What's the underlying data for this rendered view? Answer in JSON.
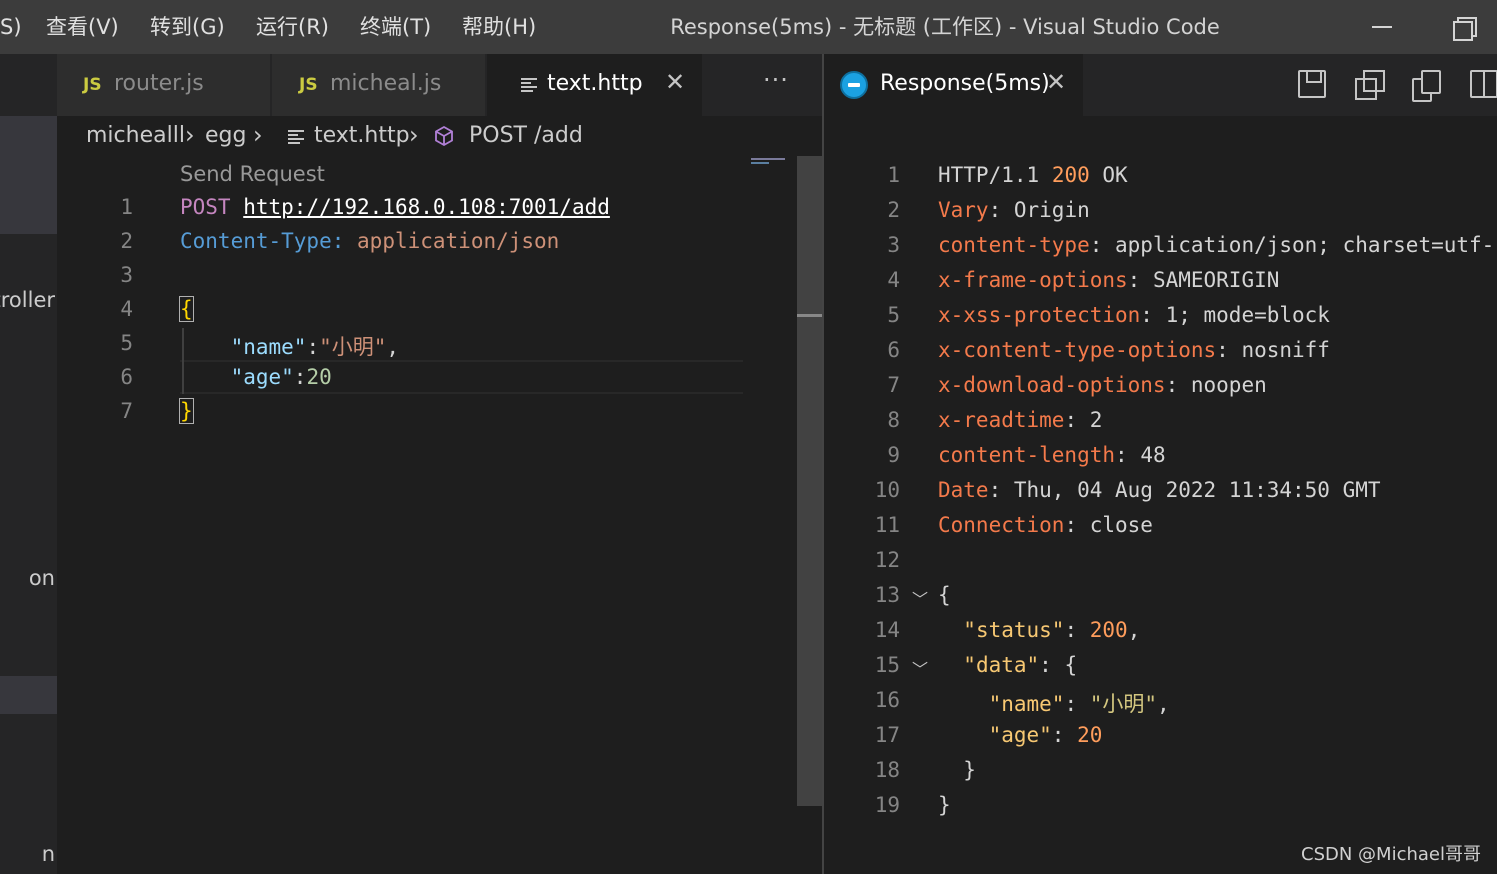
{
  "menu": [
    {
      "label": "S)"
    },
    {
      "label": "查看(V)"
    },
    {
      "label": "转到(G)"
    },
    {
      "label": "运行(R)"
    },
    {
      "label": "终端(T)"
    },
    {
      "label": "帮助(H)"
    }
  ],
  "window_title": "Response(5ms) - 无标题 (工作区) - Visual Studio Code",
  "sidebar": {
    "fragments": [
      "troller",
      "on",
      "n"
    ]
  },
  "left_tabs": [
    {
      "icon": "js-file-icon",
      "badge": "JS",
      "label": "router.js"
    },
    {
      "icon": "js-file-icon",
      "badge": "JS",
      "label": "micheal.js"
    },
    {
      "icon": "lines-file-icon",
      "label": "text.http",
      "active": true,
      "close": "✕"
    }
  ],
  "more_actions": "···",
  "breadcrumb": {
    "items": [
      "michealll",
      "egg",
      "text.http",
      "POST /add"
    ],
    "separator": "›"
  },
  "request_editor": {
    "codelens": "Send Request",
    "line_numbers": [
      "1",
      "2",
      "3",
      "4",
      "5",
      "6",
      "7"
    ],
    "method": "POST",
    "url": "http://192.168.0.108:7001/add",
    "header_key": "Content-Type:",
    "header_value": "application/json",
    "brace_open": "{",
    "body_name_key": "\"name\"",
    "body_name_sep": ":",
    "body_name_value": "\"小明\"",
    "body_name_comma": ",",
    "body_age_key": "\"age\"",
    "body_age_sep": ":",
    "body_age_value": "20",
    "brace_close": "}"
  },
  "response_tab": {
    "label": "Response(5ms)",
    "close": "✕"
  },
  "response": {
    "line_numbers": [
      "1",
      "2",
      "3",
      "4",
      "5",
      "6",
      "7",
      "8",
      "9",
      "10",
      "11",
      "12",
      "13",
      "14",
      "15",
      "16",
      "17",
      "18",
      "19"
    ],
    "status_proto": "HTTP/1.1",
    "status_code": "200",
    "status_text": "OK",
    "headers": [
      {
        "key": "Vary",
        "value": "Origin"
      },
      {
        "key": "content-type",
        "value": "application/json; charset=utf-"
      },
      {
        "key": "x-frame-options",
        "value": "SAMEORIGIN"
      },
      {
        "key": "x-xss-protection",
        "value": "1; mode=block"
      },
      {
        "key": "x-content-type-options",
        "value": "nosniff"
      },
      {
        "key": "x-download-options",
        "value": "noopen"
      },
      {
        "key": "x-readtime",
        "value": "2"
      },
      {
        "key": "content-length",
        "value": "48"
      },
      {
        "key": "Date",
        "value": "Thu, 04 Aug 2022 11:34:50 GMT"
      },
      {
        "key": "Connection",
        "value": "close"
      }
    ],
    "body": {
      "open": "{",
      "status_key": "\"status\"",
      "status_value": "200",
      "data_key": "\"data\"",
      "data_open": "{",
      "name_key": "\"name\"",
      "name_value": "\"小明\"",
      "age_key": "\"age\"",
      "age_value": "20",
      "data_close": "}",
      "close": "}"
    }
  },
  "watermark": "CSDN @Michael哥哥"
}
